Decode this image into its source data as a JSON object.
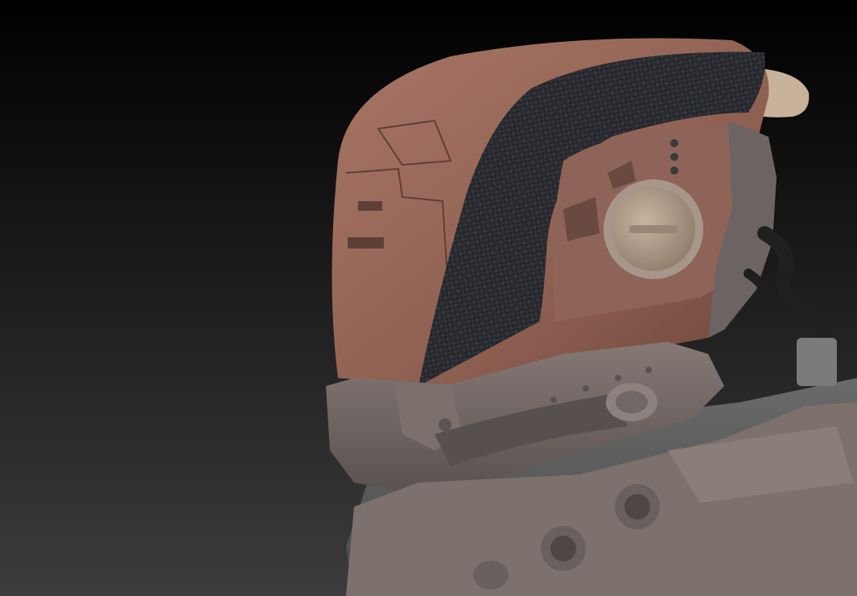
{
  "colors": {
    "background_top": "#000000",
    "background_bottom": "#3c3c3c",
    "shell_copper": "#9a6a5c",
    "shell_copper_dark": "#7a5045",
    "carbon_fiber": "#2a2c30",
    "armor_gray": "#6e6461",
    "armor_gray_light": "#8a7e79",
    "undersuit_gray": "#5f5f5f",
    "fin_tan": "#c9b29b",
    "hose_black": "#202020"
  },
  "icons": {
    "subject": "helmet-3d-render"
  }
}
